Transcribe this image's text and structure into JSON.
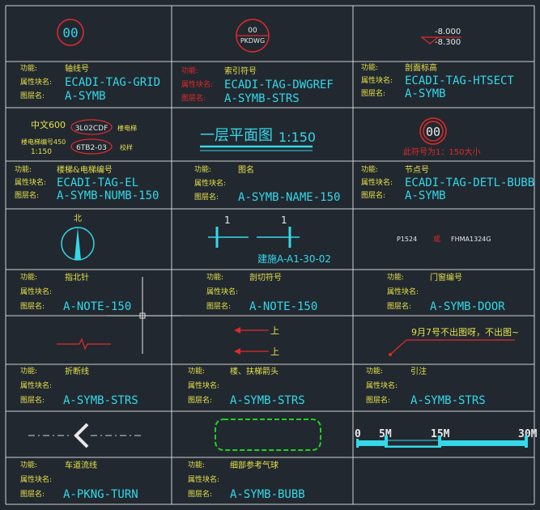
{
  "labels": {
    "function": "功能:",
    "block": "属性块名:",
    "layer": "图层名:"
  },
  "colors": {
    "background": "#212830",
    "grid": "#d0d0d0",
    "cyan": "#35d8e8",
    "yellow": "#e6e04a",
    "red": "#e22a2a",
    "green": "#22d022"
  },
  "cells": [
    {
      "func": "轴线号",
      "block": "ECADI-TAG-GRID",
      "layer": "A-SYMB"
    },
    {
      "func": "索引符号",
      "block": "ECADI-TAG-DWGREF",
      "layer": "A-SYMB-STRS"
    },
    {
      "func": "剖面标高",
      "block": "ECADI-TAG-HTSECT",
      "layer": "A-SYMB"
    },
    {
      "func": "楼梯&电梯编号",
      "block": "ECADI-TAG-EL",
      "layer": "A-SYMB-NUMB-150"
    },
    {
      "func": "图名",
      "block": "",
      "layer": "A-SYMB-NAME-150"
    },
    {
      "func": "节点号",
      "block": "ECADI-TAG-DETL-BUBB",
      "layer": "A-SYMB"
    },
    {
      "func": "指北针",
      "block": "",
      "layer": "A-NOTE-150"
    },
    {
      "func": "剖切符号",
      "block": "",
      "layer": "A-NOTE-150"
    },
    {
      "func": "门窗编号",
      "block": "",
      "layer": "A-SYMB-DOOR"
    },
    {
      "func": "折断线",
      "block": "",
      "layer": "A-SYMB-STRS"
    },
    {
      "func": "楼、扶梯箭头",
      "block": "",
      "layer": "A-SYMB-STRS"
    },
    {
      "func": "引注",
      "block": "",
      "layer": "A-SYMB-STRS"
    },
    {
      "func": "车道流线",
      "block": "",
      "layer": "A-PKNG-TURN"
    },
    {
      "func": "细部参考气球",
      "block": "",
      "layer": "A-SYMB-BUBB"
    }
  ],
  "drawings": {
    "grid_bubble": "00",
    "index_top": "00",
    "index_bottom": "PKDWG",
    "elev_top": "-8.000",
    "elev_bottom": "-8.300",
    "stair_scale_text": "中文600",
    "stair_tag1": "3L02CDF",
    "stair_tag1_note": "楼电梯",
    "stair_num_text": "楼电梯编号450",
    "stair_tag2": "6TB2-03",
    "stair_tag2_note": "校样",
    "stair_scale2": "1:150",
    "plan_title": "一层平面图",
    "plan_scale": "1:150",
    "detail_bubble": "00",
    "detail_note": "此符号为1：150大小",
    "north_label": "北",
    "section_num1": "1",
    "section_num2": "1",
    "section_ref": "建施A-A1-30-02",
    "door_tag1": "P1524",
    "door_tag_mid": "或",
    "door_tag2": "FHMA1324G",
    "stair_up1": "上",
    "stair_up2": "上",
    "leader_note": "9月7号不出图呀，不出图~",
    "scale_0": "0",
    "scale_5": "5M",
    "scale_15": "15M",
    "scale_30": "30M"
  }
}
